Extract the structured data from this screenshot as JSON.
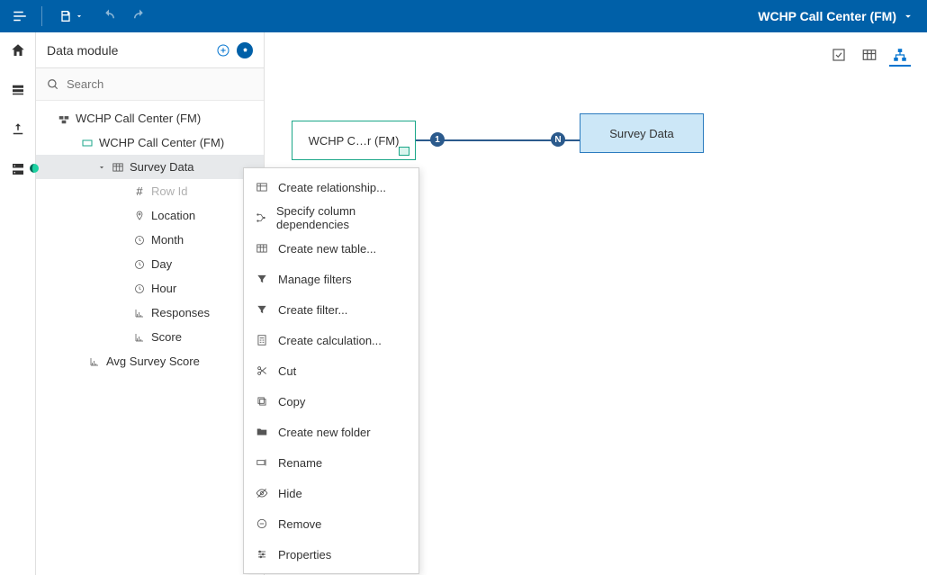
{
  "topbar": {
    "title": "WCHP Call Center (FM)"
  },
  "panel": {
    "title": "Data module",
    "search_placeholder": "Search"
  },
  "tree": {
    "root": "WCHP Call Center (FM)",
    "pkg": "WCHP Call Center (FM)",
    "table": "Survey Data",
    "cols": {
      "rowid": "Row Id",
      "location": "Location",
      "month": "Month",
      "day": "Day",
      "hour": "Hour",
      "responses": "Responses",
      "score": "Score"
    },
    "calc": "Avg Survey Score"
  },
  "diagram": {
    "left": "WCHP C…r (FM)",
    "right": "Survey Data",
    "badge1": "1",
    "badgeN": "N"
  },
  "ctx": {
    "createRel": "Create relationship...",
    "colDeps": "Specify column dependencies",
    "newTable": "Create new table...",
    "manageFilters": "Manage filters",
    "createFilter": "Create filter...",
    "createCalc": "Create calculation...",
    "cut": "Cut",
    "copy": "Copy",
    "newFolder": "Create new folder",
    "rename": "Rename",
    "hide": "Hide",
    "remove": "Remove",
    "properties": "Properties"
  }
}
